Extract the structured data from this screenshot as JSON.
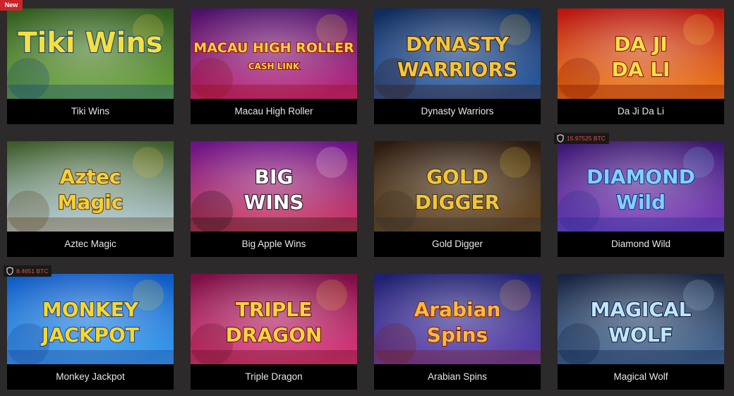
{
  "games": [
    {
      "title": "Tiki Wins",
      "logo": [
        "Tiki Wins"
      ],
      "badge": "New",
      "colors": {
        "bg1": "#2f5a1d",
        "bg2": "#6aa53a",
        "text": "#f7e03c",
        "stroke": "#0e3b7a"
      }
    },
    {
      "title": "Macau High Roller",
      "logo": [
        "MACAU HIGH ROLLER",
        "CASH LINK"
      ],
      "colors": {
        "bg1": "#4a0f6b",
        "bg2": "#c2287e",
        "text": "#ffd23b",
        "stroke": "#8b0e12"
      }
    },
    {
      "title": "Dynasty Warriors",
      "logo": [
        "DYNASTY",
        "WARRIORS"
      ],
      "colors": {
        "bg1": "#0e2a5a",
        "bg2": "#2c5fa8",
        "text": "#f3c63c",
        "stroke": "#3a1405"
      }
    },
    {
      "title": "Da Ji Da Li",
      "logo": [
        "DA JI",
        "DA LI"
      ],
      "colors": {
        "bg1": "#b81410",
        "bg2": "#f07f16",
        "text": "#ffe14a",
        "stroke": "#7a0a05"
      }
    },
    {
      "title": "Aztec Magic",
      "logo": [
        "Aztec",
        "Magic"
      ],
      "colors": {
        "bg1": "#3b5a26",
        "bg2": "#b7cfdc",
        "text": "#f5cf3a",
        "stroke": "#5a3a0c"
      }
    },
    {
      "title": "Big Apple Wins",
      "logo": [
        "BIG",
        "WINS"
      ],
      "colors": {
        "bg1": "#6a1187",
        "bg2": "#d23a5f",
        "text": "#ffffff",
        "stroke": "#111111"
      }
    },
    {
      "title": "Gold Digger",
      "logo": [
        "GOLD",
        "DIGGER"
      ],
      "colors": {
        "bg1": "#2a1a0f",
        "bg2": "#6b4a22",
        "text": "#f5c531",
        "stroke": "#2b2b30"
      }
    },
    {
      "title": "Diamond Wild",
      "logo": [
        "DIAMOND",
        "Wild"
      ],
      "jackpot": "15.97525 BTC",
      "colors": {
        "bg1": "#3a1670",
        "bg2": "#7f3fbf",
        "text": "#7fd2ff",
        "stroke": "#1a2f8a"
      }
    },
    {
      "title": "Monkey Jackpot",
      "logo": [
        "MONKEY",
        "JACKPOT"
      ],
      "jackpot": "8.4651 BTC",
      "colors": {
        "bg1": "#0d58c4",
        "bg2": "#3aa0ef",
        "text": "#f9d827",
        "stroke": "#1b3a90"
      }
    },
    {
      "title": "Triple Dragon",
      "logo": [
        "TRIPLE",
        "DRAGON"
      ],
      "colors": {
        "bg1": "#7a0d44",
        "bg2": "#e23a7f",
        "text": "#fbd33c",
        "stroke": "#5a0a1a"
      }
    },
    {
      "title": "Arabian Spins",
      "logo": [
        "Arabian",
        "Spins"
      ],
      "colors": {
        "bg1": "#1d1f6e",
        "bg2": "#5b3fb4",
        "text": "#ffb83a",
        "stroke": "#7a1a05"
      }
    },
    {
      "title": "Magical Wolf",
      "logo": [
        "MAGICAL",
        "WOLF"
      ],
      "colors": {
        "bg1": "#16223e",
        "bg2": "#4a6f9c",
        "text": "#bfe6ff",
        "stroke": "#0b1638"
      }
    }
  ]
}
